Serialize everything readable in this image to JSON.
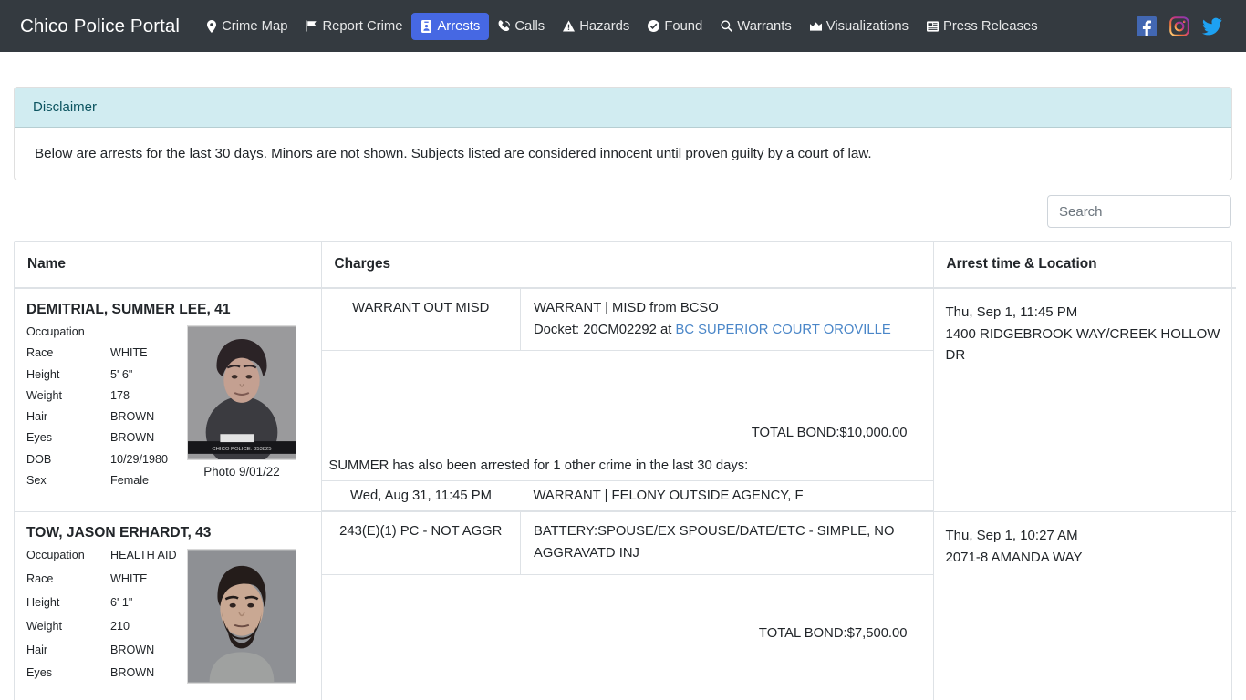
{
  "nav": {
    "brand": "Chico Police Portal",
    "items": [
      {
        "label": "Crime Map",
        "icon": "map-marker-icon",
        "active": false
      },
      {
        "label": "Report Crime",
        "icon": "flag-icon",
        "active": false
      },
      {
        "label": "Arrests",
        "icon": "id-badge-icon",
        "active": true
      },
      {
        "label": "Calls",
        "icon": "phone-volume-icon",
        "active": false
      },
      {
        "label": "Hazards",
        "icon": "warning-triangle-icon",
        "active": false
      },
      {
        "label": "Found",
        "icon": "check-circle-icon",
        "active": false
      },
      {
        "label": "Warrants",
        "icon": "search-icon",
        "active": false
      },
      {
        "label": "Visualizations",
        "icon": "chart-area-icon",
        "active": false
      },
      {
        "label": "Press Releases",
        "icon": "newspaper-icon",
        "active": false
      }
    ],
    "social": [
      {
        "name": "facebook-icon",
        "color": "#4267B2"
      },
      {
        "name": "instagram-icon",
        "color": "#C13584"
      },
      {
        "name": "twitter-icon",
        "color": "#1DA1F2"
      }
    ],
    "active_color": "#4668e3",
    "background": "#343a40"
  },
  "disclaimer": {
    "header": "Disclaimer",
    "body": "Below are arrests for the last 30 days. Minors are not shown. Subjects listed are considered innocent until proven guilty by a court of law.",
    "header_bg": "#d1ecf1",
    "header_color": "#0c5460"
  },
  "search": {
    "placeholder": "Search",
    "value": ""
  },
  "table": {
    "headers": {
      "name": "Name",
      "charges": "Charges",
      "time": "Arrest time & Location"
    },
    "rows": [
      {
        "name": "DEMITRIAL, SUMMER LEE, 41",
        "attributes": [
          {
            "key": "Occupation",
            "value": ""
          },
          {
            "key": "Race",
            "value": "WHITE"
          },
          {
            "key": "Height",
            "value": "5' 6\""
          },
          {
            "key": "Weight",
            "value": "178"
          },
          {
            "key": "Hair",
            "value": "BROWN"
          },
          {
            "key": "Eyes",
            "value": "BROWN"
          },
          {
            "key": "DOB",
            "value": "10/29/1980"
          },
          {
            "key": "Sex",
            "value": "Female"
          }
        ],
        "photo_caption": "Photo 9/01/22",
        "photo_watermark": "CHICO POLICE: 353825",
        "charges": [
          {
            "code": "WARRANT OUT MISD",
            "description": "WARRANT | MISD from BCSO",
            "docket_prefix": "Docket: 20CM02292 at ",
            "docket_link": "BC SUPERIOR COURT OROVILLE"
          }
        ],
        "total_bond": "TOTAL BOND:$10,000.00",
        "also_note": "SUMMER has also been arrested for 1 other crime in the last 30 days:",
        "other_crimes": [
          {
            "when": "Wed, Aug 31, 11:45 PM",
            "what": "WARRANT | FELONY OUTSIDE AGENCY, F"
          }
        ],
        "arrest_time": "Thu, Sep 1, 11:45 PM",
        "arrest_location": "1400 RIDGEBROOK WAY/CREEK HOLLOW DR"
      },
      {
        "name": "TOW, JASON ERHARDT, 43",
        "attributes": [
          {
            "key": "Occupation",
            "value": "HEALTH AID"
          },
          {
            "key": "Race",
            "value": "WHITE"
          },
          {
            "key": "Height",
            "value": "6' 1\""
          },
          {
            "key": "Weight",
            "value": "210"
          },
          {
            "key": "Hair",
            "value": "BROWN"
          },
          {
            "key": "Eyes",
            "value": "BROWN"
          }
        ],
        "photo_caption": "",
        "photo_watermark": "",
        "charges": [
          {
            "code": "243(E)(1) PC - NOT AGGR",
            "description": "BATTERY:SPOUSE/EX SPOUSE/DATE/ETC - SIMPLE, NO AGGRAVATD INJ",
            "docket_prefix": "",
            "docket_link": ""
          }
        ],
        "total_bond": "TOTAL BOND:$7,500.00",
        "also_note": "",
        "other_crimes": [],
        "arrest_time": "Thu, Sep 1, 10:27 AM",
        "arrest_location": "2071-8 AMANDA WAY"
      }
    ]
  }
}
